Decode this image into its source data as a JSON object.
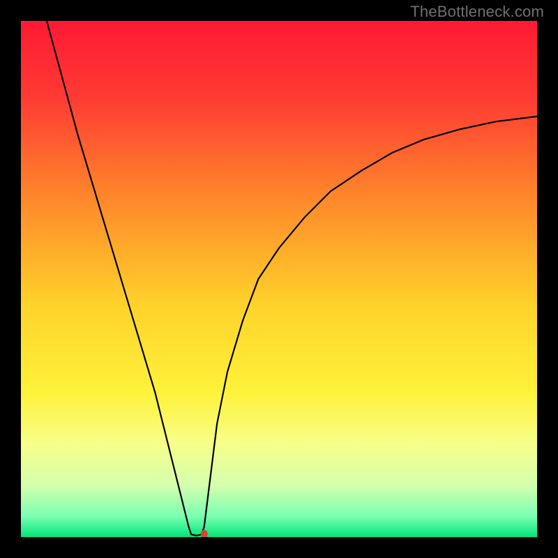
{
  "watermark": "TheBottleneck.com",
  "chart_data": {
    "type": "line",
    "title": "",
    "xlabel": "",
    "ylabel": "",
    "xlim": [
      0,
      100
    ],
    "ylim": [
      0,
      100
    ],
    "background_gradient": {
      "stops": [
        {
          "offset": 0,
          "color": "#ff1a33"
        },
        {
          "offset": 15,
          "color": "#ff3b33"
        },
        {
          "offset": 35,
          "color": "#ff8a2a"
        },
        {
          "offset": 55,
          "color": "#ffd22a"
        },
        {
          "offset": 72,
          "color": "#fff23a"
        },
        {
          "offset": 82,
          "color": "#f6ff8a"
        },
        {
          "offset": 90,
          "color": "#d4ffae"
        },
        {
          "offset": 96,
          "color": "#7affb2"
        },
        {
          "offset": 100,
          "color": "#00e57a"
        }
      ]
    },
    "series": [
      {
        "name": "bottleneck-curve",
        "type": "line",
        "color": "#000000",
        "x": [
          5,
          8,
          11,
          14,
          17,
          20,
          23,
          26,
          28,
          30,
          31.5,
          32.5,
          33,
          34,
          35,
          35.5,
          36.5,
          38,
          40,
          43,
          46,
          50,
          55,
          60,
          66,
          72,
          78,
          85,
          92,
          100
        ],
        "y": [
          100,
          89,
          78,
          68,
          58,
          48,
          38,
          28,
          20,
          12,
          6,
          2,
          0.5,
          0.3,
          0.5,
          2,
          10,
          22,
          32,
          42,
          50,
          56,
          62,
          67,
          71,
          74.5,
          77,
          79,
          80.5,
          81.5
        ]
      }
    ],
    "markers": [
      {
        "name": "optimal-point",
        "x": 35.5,
        "y": 0.6,
        "color": "#d4453a",
        "rx": 5,
        "ry": 6
      }
    ]
  }
}
